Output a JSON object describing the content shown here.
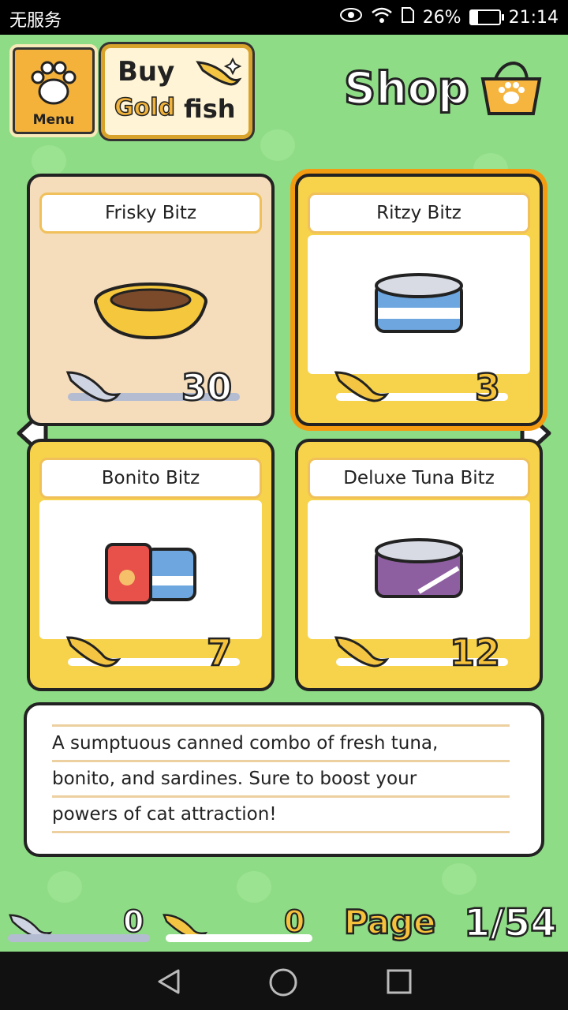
{
  "status_bar": {
    "carrier": "无服务",
    "battery": "26%",
    "time": "21:14",
    "battery_level": 0.26
  },
  "header": {
    "menu_label": "Menu",
    "buy_line1": "Buy",
    "buy_gold": "Gold",
    "buy_fish": "fish",
    "shop_title": "Shop"
  },
  "items": [
    {
      "name": "Frisky Bitz",
      "price": "30",
      "currency": "silver-fish",
      "selected": false
    },
    {
      "name": "Ritzy Bitz",
      "price": "3",
      "currency": "gold-fish",
      "selected": true
    },
    {
      "name": "Bonito Bitz",
      "price": "7",
      "currency": "gold-fish",
      "selected": false
    },
    {
      "name": "Deluxe Tuna Bitz",
      "price": "12",
      "currency": "gold-fish",
      "selected": false
    }
  ],
  "description": {
    "line1": "A sumptuous canned combo of fresh tuna,",
    "line2": "bonito, and sardines. Sure to boost your",
    "line3": "powers of cat attraction!"
  },
  "footer": {
    "silver_count": "0",
    "gold_count": "0",
    "page_label": "Page",
    "page_number": "1/54"
  },
  "colors": {
    "background": "#8fdc86",
    "card_gold": "#f7d24b",
    "card_frisky": "#f5dcbb",
    "selected_outline": "#f39c12"
  }
}
